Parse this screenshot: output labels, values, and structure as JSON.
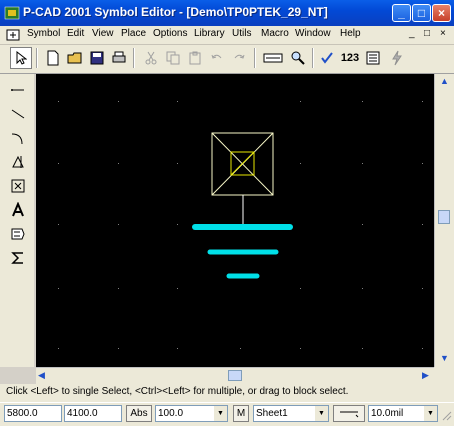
{
  "window": {
    "title": "P-CAD 2001 Symbol Editor - [Demo\\TP0PTEK_29_NT]",
    "controls": [
      "_",
      "□",
      "×"
    ]
  },
  "menu": {
    "items": [
      "Symbol",
      "Edit",
      "View",
      "Place",
      "Options",
      "Library",
      "Utils",
      "Macro",
      "Window",
      "Help"
    ],
    "mdi_controls": [
      "_",
      "□",
      "×"
    ]
  },
  "toolbar": {
    "label_123": "123"
  },
  "canvas": {
    "background": "#000000",
    "symbol_color": "#f8f8c8",
    "pin_color": "#ffffff",
    "bar_color": "#00e0e8",
    "highlight_color": "#e8e800"
  },
  "prompt": {
    "text": "Click <Left> to single Select, <Ctrl><Left> for multiple, or drag to block select."
  },
  "status": {
    "x": "5800.0",
    "y": "4100.0",
    "abs": "Abs",
    "grid": "100.0",
    "mode": "M",
    "sheet": "Sheet1",
    "units": "10.0mil"
  }
}
